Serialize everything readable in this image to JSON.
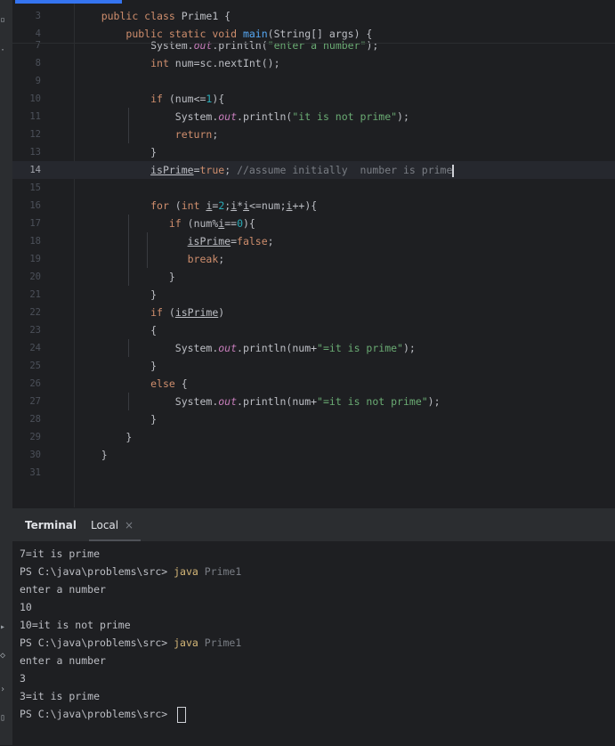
{
  "sidebar": {
    "icons": [
      "project-tool-icon",
      "more-dots-icon",
      "services-icon",
      "problems-icon",
      "terminal-tool-icon",
      "git-tool-icon"
    ]
  },
  "editor": {
    "current_line": "14",
    "lines": [
      {
        "n": "3",
        "tokens": [
          {
            "t": "    "
          },
          {
            "t": "public class ",
            "c": "kw"
          },
          {
            "t": "Prime1 {"
          }
        ]
      },
      {
        "n": "4",
        "tokens": [
          {
            "t": "        "
          },
          {
            "t": "public static void ",
            "c": "kw"
          },
          {
            "t": "main",
            "c": "fn"
          },
          {
            "t": "(String[] args) {"
          }
        ]
      },
      {
        "n": "7",
        "tokens": [
          {
            "t": "            System."
          },
          {
            "t": "out",
            "c": "it"
          },
          {
            "t": ".println("
          },
          {
            "t": "\"enter a number\"",
            "c": "st"
          },
          {
            "t": ");"
          }
        ]
      },
      {
        "n": "8",
        "tokens": [
          {
            "t": "            "
          },
          {
            "t": "int ",
            "c": "kw"
          },
          {
            "t": "num=sc.nextInt();"
          }
        ]
      },
      {
        "n": "9",
        "tokens": []
      },
      {
        "n": "10",
        "tokens": [
          {
            "t": "            "
          },
          {
            "t": "if ",
            "c": "kw"
          },
          {
            "t": "(num<="
          },
          {
            "t": "1",
            "c": "nm"
          },
          {
            "t": "){"
          }
        ]
      },
      {
        "n": "11",
        "tokens": [
          {
            "t": "                System."
          },
          {
            "t": "out",
            "c": "it"
          },
          {
            "t": ".println("
          },
          {
            "t": "\"it is not prime\"",
            "c": "st"
          },
          {
            "t": ");"
          }
        ]
      },
      {
        "n": "12",
        "tokens": [
          {
            "t": "                "
          },
          {
            "t": "return",
            "c": "kw"
          },
          {
            "t": ";"
          }
        ]
      },
      {
        "n": "13",
        "tokens": [
          {
            "t": "            }"
          }
        ]
      },
      {
        "n": "14",
        "tokens": [
          {
            "t": "            "
          },
          {
            "t": "isPrime",
            "c": "ul"
          },
          {
            "t": "="
          },
          {
            "t": "true",
            "c": "kw"
          },
          {
            "t": "; "
          },
          {
            "t": "//assume initially  number is prime",
            "c": "cm"
          }
        ]
      },
      {
        "n": "15",
        "tokens": []
      },
      {
        "n": "16",
        "tokens": [
          {
            "t": "            "
          },
          {
            "t": "for ",
            "c": "kw"
          },
          {
            "t": "("
          },
          {
            "t": "int ",
            "c": "kw"
          },
          {
            "t": "i",
            "c": "ul"
          },
          {
            "t": "="
          },
          {
            "t": "2",
            "c": "nm"
          },
          {
            "t": ";"
          },
          {
            "t": "i",
            "c": "ul"
          },
          {
            "t": "*"
          },
          {
            "t": "i",
            "c": "ul"
          },
          {
            "t": "<=num;"
          },
          {
            "t": "i",
            "c": "ul"
          },
          {
            "t": "++){"
          }
        ]
      },
      {
        "n": "17",
        "tokens": [
          {
            "t": "               "
          },
          {
            "t": "if ",
            "c": "kw"
          },
          {
            "t": "(num%"
          },
          {
            "t": "i",
            "c": "ul"
          },
          {
            "t": "=="
          },
          {
            "t": "0",
            "c": "nm"
          },
          {
            "t": "){"
          }
        ]
      },
      {
        "n": "18",
        "tokens": [
          {
            "t": "                  "
          },
          {
            "t": "isPrime",
            "c": "ul"
          },
          {
            "t": "="
          },
          {
            "t": "false",
            "c": "kw"
          },
          {
            "t": ";"
          }
        ]
      },
      {
        "n": "19",
        "tokens": [
          {
            "t": "                  "
          },
          {
            "t": "break",
            "c": "kw"
          },
          {
            "t": ";"
          }
        ]
      },
      {
        "n": "20",
        "tokens": [
          {
            "t": "               }"
          }
        ]
      },
      {
        "n": "21",
        "tokens": [
          {
            "t": "            }"
          }
        ]
      },
      {
        "n": "22",
        "tokens": [
          {
            "t": "            "
          },
          {
            "t": "if ",
            "c": "kw"
          },
          {
            "t": "("
          },
          {
            "t": "isPrime",
            "c": "ul"
          },
          {
            "t": ")"
          }
        ]
      },
      {
        "n": "23",
        "tokens": [
          {
            "t": "            {"
          }
        ]
      },
      {
        "n": "24",
        "tokens": [
          {
            "t": "                System."
          },
          {
            "t": "out",
            "c": "it"
          },
          {
            "t": ".println(num+"
          },
          {
            "t": "\"=it is prime\"",
            "c": "st"
          },
          {
            "t": ");"
          }
        ]
      },
      {
        "n": "25",
        "tokens": [
          {
            "t": "            }"
          }
        ]
      },
      {
        "n": "26",
        "tokens": [
          {
            "t": "            "
          },
          {
            "t": "else ",
            "c": "kw"
          },
          {
            "t": "{"
          }
        ]
      },
      {
        "n": "27",
        "tokens": [
          {
            "t": "                System."
          },
          {
            "t": "out",
            "c": "it"
          },
          {
            "t": ".println(num+"
          },
          {
            "t": "\"=it is not prime\"",
            "c": "st"
          },
          {
            "t": ");"
          }
        ]
      },
      {
        "n": "28",
        "tokens": [
          {
            "t": "            }"
          }
        ]
      },
      {
        "n": "29",
        "tokens": [
          {
            "t": "        }"
          }
        ]
      },
      {
        "n": "30",
        "tokens": [
          {
            "t": "    }"
          }
        ]
      },
      {
        "n": "31",
        "tokens": []
      }
    ]
  },
  "terminal": {
    "title": "Terminal",
    "tab_label": "Local",
    "close_glyph": "×",
    "lines": [
      {
        "text": "7=it is prime"
      },
      {
        "prompt": "PS C:\\java\\problems\\src> ",
        "cmd": "java",
        "arg": " Prime1"
      },
      {
        "text": "enter a number"
      },
      {
        "text": "10"
      },
      {
        "text": "10=it is not prime"
      },
      {
        "prompt": "PS C:\\java\\problems\\src> ",
        "cmd": "java",
        "arg": " Prime1"
      },
      {
        "text": "enter a number"
      },
      {
        "text": "3"
      },
      {
        "text": "3=it is prime"
      },
      {
        "prompt": "PS C:\\java\\problems\\src> ",
        "cursor": true
      }
    ]
  }
}
